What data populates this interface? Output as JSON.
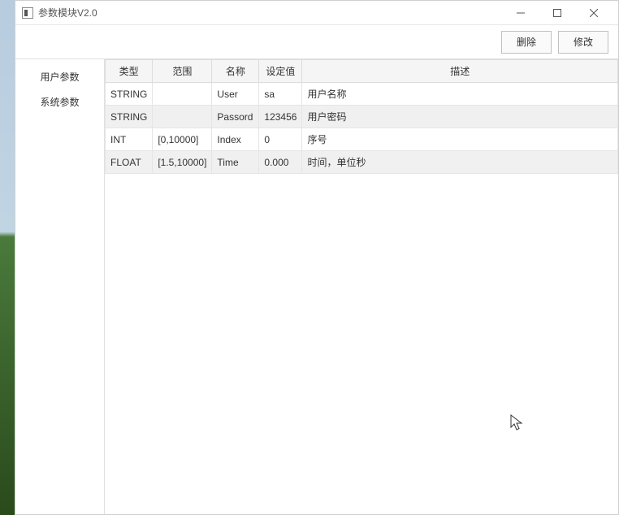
{
  "window": {
    "title": "参数模块V2.0"
  },
  "toolbar": {
    "delete_label": "删除",
    "edit_label": "修改"
  },
  "sidebar": {
    "items": [
      {
        "label": "用户参数"
      },
      {
        "label": "系统参数"
      }
    ]
  },
  "table": {
    "headers": {
      "type": "类型",
      "range": "范围",
      "name": "名称",
      "value": "设定值",
      "desc": "描述"
    },
    "rows": [
      {
        "type": "STRING",
        "range": "",
        "name": "User",
        "value": "sa",
        "desc": "用户名称"
      },
      {
        "type": "STRING",
        "range": "",
        "name": "Passord",
        "value": "123456",
        "desc": "用户密码"
      },
      {
        "type": "INT",
        "range": "[0,10000]",
        "name": "Index",
        "value": "0",
        "desc": "序号"
      },
      {
        "type": "FLOAT",
        "range": "[1.5,10000]",
        "name": "Time",
        "value": "0.000",
        "desc": "时间，单位秒"
      }
    ]
  }
}
